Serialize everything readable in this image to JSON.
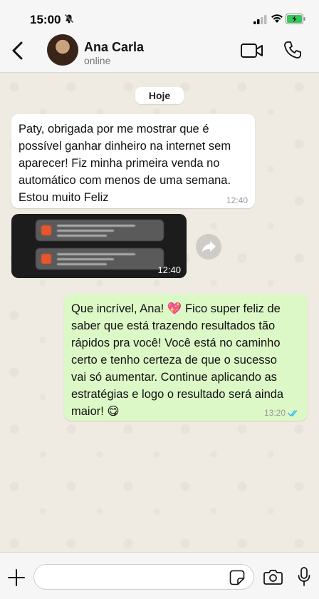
{
  "status_bar": {
    "time": "15:00"
  },
  "header": {
    "contact_name": "Ana Carla",
    "contact_status": "online"
  },
  "chat": {
    "date_chip": "Hoje",
    "messages": [
      {
        "direction": "incoming",
        "text": "Paty, obrigada por me mostrar que é\npossível ganhar dinheiro na internet sem\naparecer! Fiz minha primeira venda no\nautomático com menos de uma semana.\nEstou muito Feliz",
        "time": "12:40"
      },
      {
        "direction": "incoming",
        "type": "image",
        "time": "12:40"
      },
      {
        "direction": "outgoing",
        "text": "Que incrível, Ana! 💖 Fico super feliz de\nsaber que  está trazendo resultados tão\nrápidos pra você! Você está no caminho\ncerto e tenho certeza de que o sucesso\nvai só aumentar. Continue aplicando as\nestratégias e logo o resultado será ainda\nmaior! 😋",
        "time": "13:20",
        "status": "read"
      }
    ]
  },
  "input_bar": {
    "value": "",
    "placeholder": ""
  },
  "colors": {
    "outgoing_bubble": "#dcf8c6",
    "incoming_bubble": "#ffffff",
    "read_ticks": "#34b7f1",
    "background": "#efeae2"
  },
  "icons": [
    "bell-off-icon",
    "signal-icon",
    "wifi-icon",
    "battery-icon",
    "back-icon",
    "video-call-icon",
    "phone-icon",
    "forward-icon",
    "plus-icon",
    "sticker-icon",
    "camera-icon",
    "mic-icon",
    "double-check-icon"
  ]
}
